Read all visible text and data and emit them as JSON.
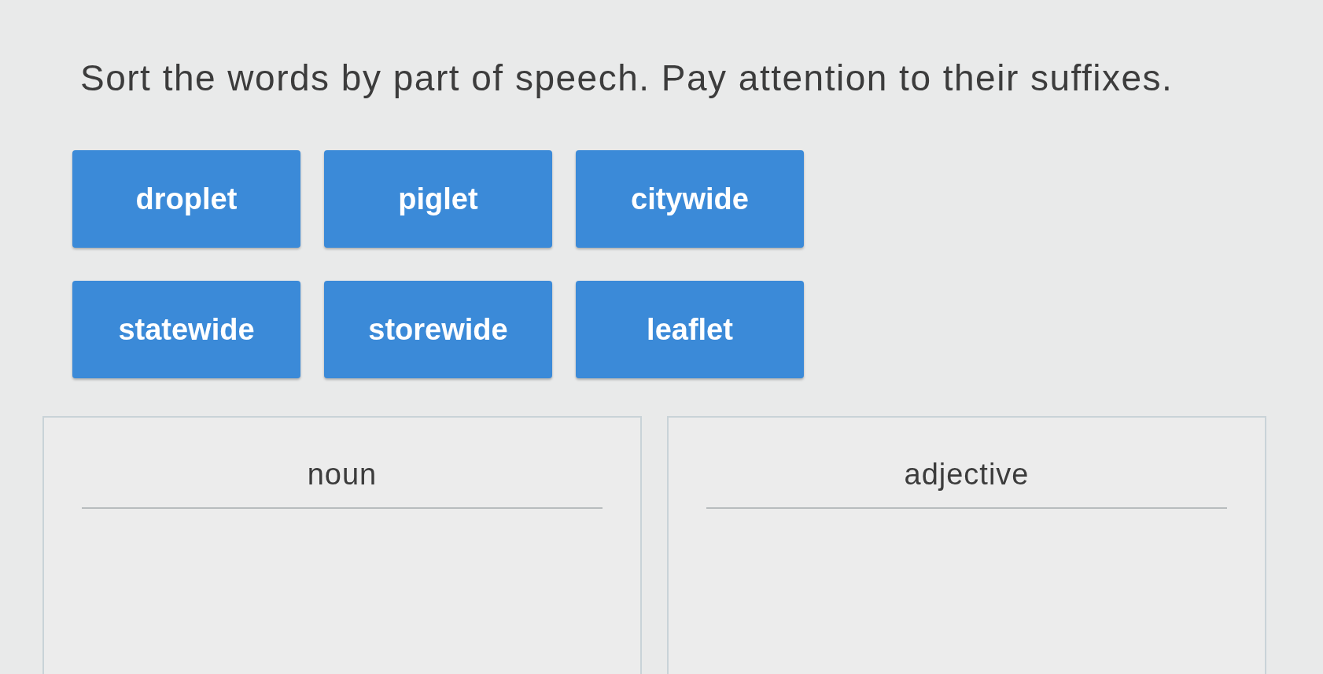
{
  "instruction": "Sort the words by part of speech. Pay attention to their suffixes.",
  "word_tiles": [
    {
      "label": "droplet"
    },
    {
      "label": "piglet"
    },
    {
      "label": "citywide"
    },
    {
      "label": "statewide"
    },
    {
      "label": "storewide"
    },
    {
      "label": "leaflet"
    }
  ],
  "categories": [
    {
      "label": "noun"
    },
    {
      "label": "adjective"
    }
  ]
}
